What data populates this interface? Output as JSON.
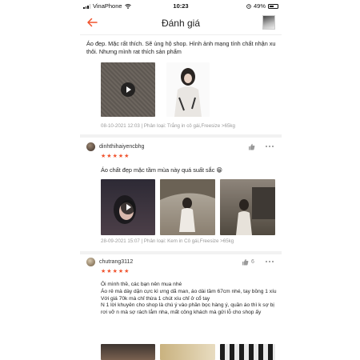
{
  "status_bar": {
    "carrier": "VinaPhone",
    "time": "10:23",
    "battery": "49%"
  },
  "header": {
    "title": "Đánh giá"
  },
  "reviews": [
    {
      "text": "Áo đẹp. Mặc rất thích. Sẽ ủng hộ shop. Hình ảnh mạng tính chất nhận xu thôi. Nhưng mình rat thích sản phẩm",
      "meta": "08-10-2021 12:03 | Phân loại: Trắng in cô gái,Freesize >65kg"
    },
    {
      "username": "dinhthihaiyencbhg",
      "stars": 5,
      "text": "Áo chất đẹp mặc tầm mùa này quá suất sắc 😁",
      "meta": "28-09-2021 15:07 | Phân loại: Kem in Cô gái,Freesize >65kg"
    },
    {
      "username": "chutrang3112",
      "likes": "6",
      "stars": 5,
      "text": "Ôi mình thề, các bạn nên mua nhé\nÁo rẻ mà dày dặn cực kì ưng dã man, áo dài tầm 67cm nhé, tay bồng 1 xíu\nVới giá 70k mà chỉ thừa 1 chút xíu chỉ ở cổ tay\nN 1 lời khuyên cho shop là chú ý vào phần bọc hàng ý, quần áo thì k sợ bị rơi vỡ n mà sợ rách lắm nha, mất công khách mà gửi lỗ cho shop ấy"
    }
  ],
  "colors": {
    "accent": "#f0532d",
    "star": "#f0532d",
    "muted": "#9a9a9a"
  },
  "icons": [
    "back-arrow-icon",
    "play-icon",
    "thumbs-up-icon",
    "more-icon",
    "star-icon"
  ]
}
